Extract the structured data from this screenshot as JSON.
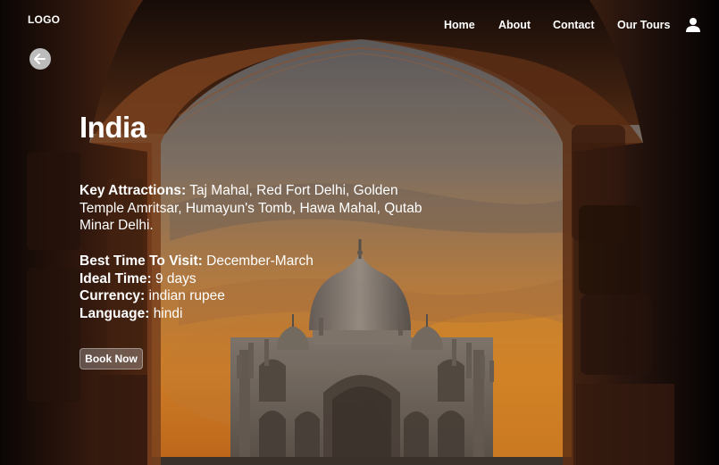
{
  "header": {
    "logo": "LOGO",
    "nav": [
      {
        "label": "Home"
      },
      {
        "label": "About"
      },
      {
        "label": "Contact"
      },
      {
        "label": "Our Tours"
      }
    ],
    "user_icon": "user-icon"
  },
  "back_icon": "arrow-left-icon",
  "destination": {
    "title": "India",
    "attractions_label": "Key Attractions:",
    "attractions_value": "Taj Mahal, Red Fort Delhi, Golden Temple Amritsar, Humayun's Tomb, Hawa Mahal, Qutab Minar Delhi.",
    "facts": [
      {
        "label": "Best Time To Visit:",
        "value": "December-March"
      },
      {
        "label": "Ideal Time:",
        "value": "9 days"
      },
      {
        "label": "Currency:",
        "value": "indian rupee"
      },
      {
        "label": "Language:",
        "value": "hindi"
      }
    ]
  },
  "cta": {
    "label": "Book Now"
  },
  "colors": {
    "text": "#ffffff",
    "sky_top": "#6f6e70",
    "sky_bottom": "#e48a2a",
    "arch": "#3a1f12"
  }
}
